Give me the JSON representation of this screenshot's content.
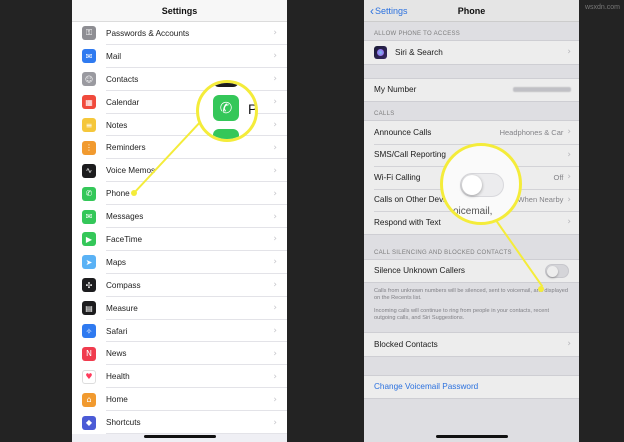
{
  "watermark": "wsxdn.com",
  "left": {
    "title": "Settings",
    "items": [
      {
        "label": "Passwords & Accounts",
        "icon": "key-icon",
        "glyph": "⚿",
        "color": "#8e8e93"
      },
      {
        "label": "Mail",
        "icon": "mail-icon",
        "glyph": "✉",
        "color": "#2f7af0"
      },
      {
        "label": "Contacts",
        "icon": "contacts-icon",
        "glyph": "☺",
        "color": "#9a9aa0"
      },
      {
        "label": "Calendar",
        "icon": "calendar-icon",
        "glyph": "▦",
        "color": "#f04a3c"
      },
      {
        "label": "Notes",
        "icon": "notes-icon",
        "glyph": "≡",
        "color": "#f5c73b"
      },
      {
        "label": "Reminders",
        "icon": "reminders-icon",
        "glyph": "⋮",
        "color": "#f19a2f"
      },
      {
        "label": "Voice Memos",
        "icon": "voice-memos-icon",
        "glyph": "∿",
        "color": "#1c1c1e"
      },
      {
        "label": "Phone",
        "icon": "phone-icon",
        "glyph": "✆",
        "color": "#34c759"
      },
      {
        "label": "Messages",
        "icon": "messages-icon",
        "glyph": "✉",
        "color": "#34c759"
      },
      {
        "label": "FaceTime",
        "icon": "facetime-icon",
        "glyph": "▶",
        "color": "#34c759"
      },
      {
        "label": "Maps",
        "icon": "maps-icon",
        "glyph": "➤",
        "color": "#5ab2f5"
      },
      {
        "label": "Compass",
        "icon": "compass-icon",
        "glyph": "✣",
        "color": "#1c1c1e"
      },
      {
        "label": "Measure",
        "icon": "measure-icon",
        "glyph": "▤",
        "color": "#1c1c1e"
      },
      {
        "label": "Safari",
        "icon": "safari-icon",
        "glyph": "✧",
        "color": "#2f7af0"
      },
      {
        "label": "News",
        "icon": "news-icon",
        "glyph": "N",
        "color": "#f03c4e"
      },
      {
        "label": "Health",
        "icon": "health-icon",
        "glyph": "♥",
        "color": "#ffffff"
      },
      {
        "label": "Home",
        "icon": "home-icon",
        "glyph": "⌂",
        "color": "#f19a2f"
      },
      {
        "label": "Shortcuts",
        "icon": "shortcuts-icon",
        "glyph": "◆",
        "color": "#4b5bd6"
      }
    ],
    "lens_text": "P"
  },
  "right": {
    "back_label": "Settings",
    "title": "Phone",
    "allow_header": "ALLOW PHONE TO ACCESS",
    "siri_label": "Siri & Search",
    "my_number_label": "My Number",
    "calls_header": "CALLS",
    "calls_rows": [
      {
        "label": "Announce Calls",
        "value": "Headphones & Car"
      },
      {
        "label": "SMS/Call Reporting",
        "value": ""
      },
      {
        "label": "Wi-Fi Calling",
        "value": "Off"
      },
      {
        "label": "Calls on Other Devices",
        "value": "When Nearby"
      },
      {
        "label": "Respond with Text",
        "value": ""
      }
    ],
    "silencing_header": "CALL SILENCING AND BLOCKED CONTACTS",
    "silence_label": "Silence Unknown Callers",
    "silence_on": false,
    "footnote1": "Calls from unknown numbers will be silenced, sent to voicemail, and displayed on the Recents list.",
    "footnote2": "Incoming calls will continue to ring from people in your contacts, recent outgoing calls, and Siri Suggestions.",
    "blocked_label": "Blocked Contacts",
    "voicemail_label": "Change Voicemail Password",
    "lens_text": "oicemail,"
  },
  "accent": "#f4ec3a"
}
